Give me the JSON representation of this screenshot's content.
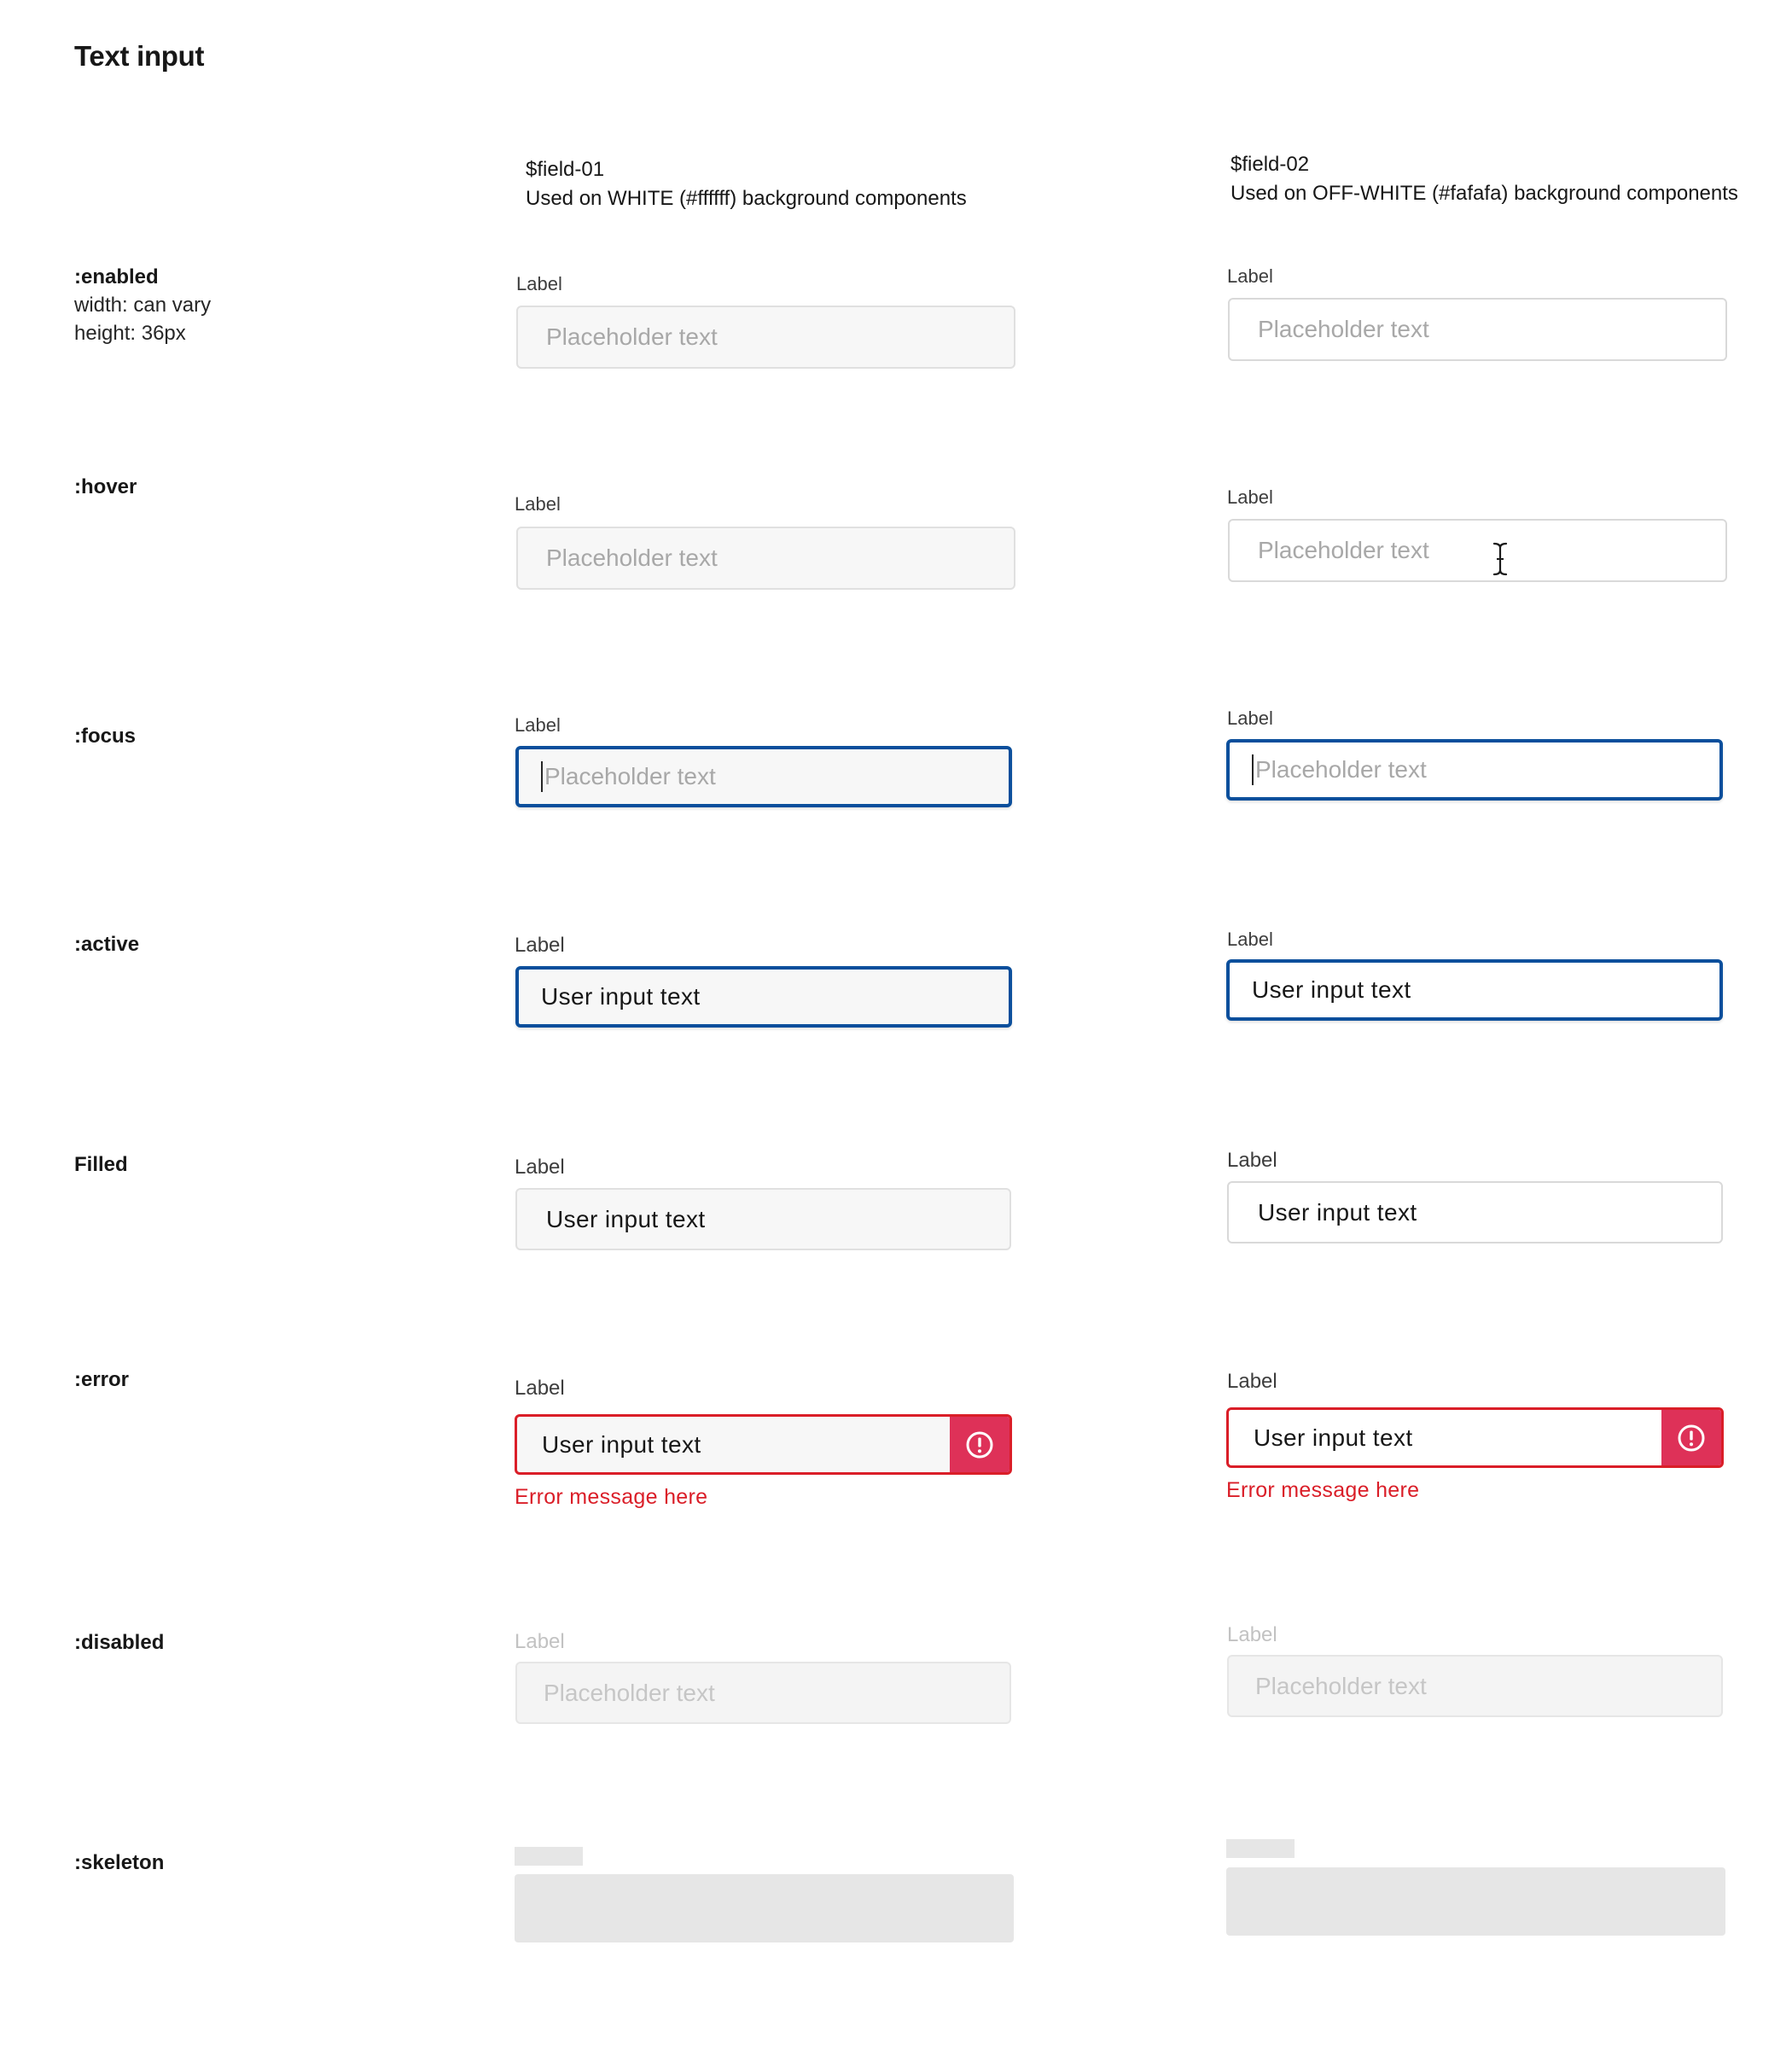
{
  "title": "Text input",
  "columns": [
    {
      "token": "$field-01",
      "description": "Used on WHITE (#ffffff) background components",
      "background": "#ffffff"
    },
    {
      "token": "$field-02",
      "description": "Used on OFF-WHITE (#fafafa) background components",
      "background": "#fafafa"
    }
  ],
  "rows": {
    "enabled": {
      "name": ":enabled",
      "note1": "width: can vary",
      "note2": "height: 36px"
    },
    "hover": {
      "name": ":hover"
    },
    "focus": {
      "name": ":focus"
    },
    "active": {
      "name": ":active"
    },
    "filled": {
      "name": "Filled"
    },
    "error": {
      "name": ":error"
    },
    "disabled": {
      "name": ":disabled"
    },
    "skeleton": {
      "name": ":skeleton"
    }
  },
  "field": {
    "label": "Label",
    "placeholder": "Placeholder text",
    "value": "User input text",
    "error_message": "Error message here",
    "error_icon": "alert-circle-icon",
    "cursor_icon": "text-cursor-icon"
  },
  "colors": {
    "focus_border": "#0b4f9c",
    "error": "#da1e28",
    "error_icon_bg": "#de3158",
    "skeleton": "#e6e6e6"
  }
}
